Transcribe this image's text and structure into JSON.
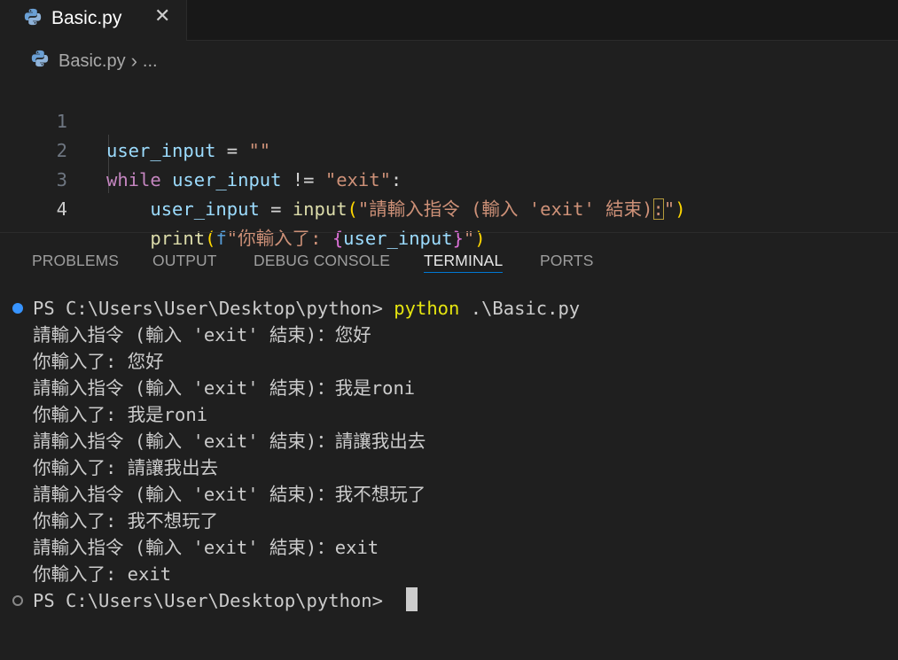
{
  "tab": {
    "title": "Basic.py",
    "close": "✕",
    "icon": "python-icon"
  },
  "breadcrumb": {
    "file": "Basic.py",
    "separator": "›",
    "more": "..."
  },
  "editor": {
    "line_numbers": [
      "1",
      "2",
      "3",
      "4"
    ],
    "active_line": "4",
    "lines": [
      {
        "t1": "user_input",
        "t2": " = ",
        "t3": "\"\""
      },
      {
        "t1": "while",
        "t2": " ",
        "t3": "user_input",
        "t4": " != ",
        "t5": "\"exit\"",
        "t6": ":"
      },
      {
        "t1": "    ",
        "t2": "user_input",
        "t3": " = ",
        "t4": "input",
        "t5": "(",
        "t6": "\"請輸入指令 ",
        "t7": "(",
        "t8": "輸入 'exit' 結束",
        "t9": ")",
        "t10": ":",
        "t11": "\"",
        "t12": ")"
      },
      {
        "t1": "    ",
        "t2": "print",
        "t3": "(",
        "t4": "f",
        "t5": "\"你輸入了: ",
        "t6": "{",
        "t7": "user_input",
        "t8": "}",
        "t9": "\"",
        "t10": ")"
      }
    ]
  },
  "panel": {
    "tabs": [
      "PROBLEMS",
      "OUTPUT",
      "DEBUG CONSOLE",
      "TERMINAL",
      "PORTS"
    ],
    "active_tab": "TERMINAL"
  },
  "terminal": {
    "prompt": "PS C:\\Users\\User\\Desktop\\python> ",
    "command_name": "python",
    "command_args": " .\\Basic.py",
    "output": [
      "請輸入指令 (輸入 'exit' 結束)：您好",
      "你輸入了: 您好",
      "請輸入指令 (輸入 'exit' 結束)：我是roni",
      "你輸入了: 我是roni",
      "請輸入指令 (輸入 'exit' 結束)：請讓我出去",
      "你輸入了: 請讓我出去",
      "請輸入指令 (輸入 'exit' 結束)：我不想玩了",
      "你輸入了: 我不想玩了",
      "請輸入指令 (輸入 'exit' 結束)：exit",
      "你輸入了: exit"
    ],
    "final_prompt": "PS C:\\Users\\User\\Desktop\\python> "
  },
  "colors": {
    "background": "#1f1f1f",
    "keyword": "#c586c0",
    "variable": "#9cdcfe",
    "string": "#ce9178",
    "function": "#dcdcaa",
    "command": "#e5e510",
    "accent": "#0078d4"
  }
}
